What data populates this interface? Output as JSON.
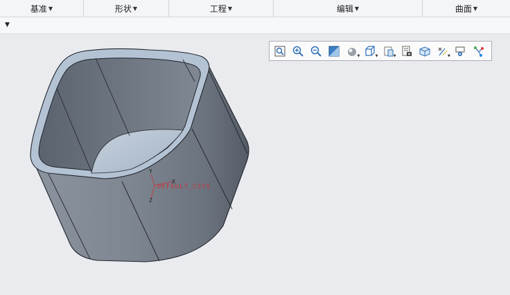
{
  "ribbon": {
    "groups": [
      {
        "label": "基准"
      },
      {
        "label": "形状"
      },
      {
        "label": "工程"
      },
      {
        "label": "编辑"
      },
      {
        "label": "曲面"
      }
    ]
  },
  "subbar": {
    "dropdown_glyph": "▼"
  },
  "view_toolbar": {
    "icons": [
      "refit-icon",
      "zoom-in-icon",
      "zoom-out-icon",
      "repaint-icon",
      "shading-icon",
      "named-views-icon",
      "saved-orientation-icon",
      "view-manager-icon",
      "perspective-icon",
      "display-style-icon",
      "datum-display-icon",
      "annotation-display-icon",
      "spin-center-icon"
    ]
  },
  "csys": {
    "x": "X",
    "y": "Y",
    "z": "Z",
    "name": "DEFAULT_CSYS"
  },
  "colors": {
    "part_dark": "#5d6571",
    "part_mid": "#7d8590",
    "part_light": "#b3c2d3",
    "csys_red": "#c8353c"
  }
}
